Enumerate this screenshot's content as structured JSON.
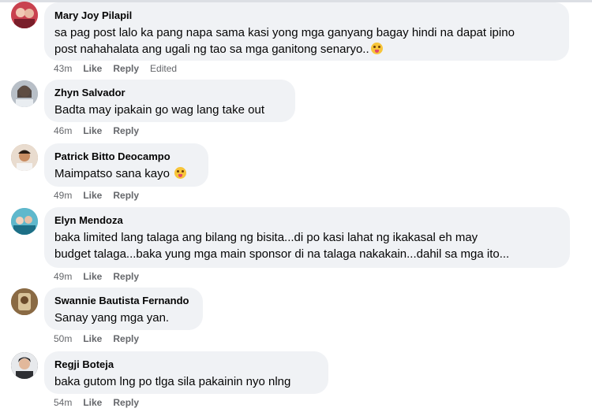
{
  "comments": [
    {
      "author": "Mary Joy Pilapil",
      "text_lines": [
        "sa pag post lalo ka pang napa sama kasi yong mga ganyang bagay hindi na dapat ipino",
        "post nahahalata ang ugali ng tao sa mga ganitong senaryo.."
      ],
      "emoji": "tongue-face-emoji",
      "time": "43m",
      "like": "Like",
      "reply": "Reply",
      "edited": "Edited",
      "avatar_color": "#d64d5a"
    },
    {
      "author": "Zhyn Salvador",
      "text_lines": [
        "Badta may ipakain go wag lang take out"
      ],
      "time": "46m",
      "like": "Like",
      "reply": "Reply",
      "avatar_color": "#9aa3ad"
    },
    {
      "author": "Patrick Bitto Deocampo",
      "text_lines": [
        "Maimpatso sana kayo "
      ],
      "emoji": "tongue-face-emoji",
      "time": "49m",
      "like": "Like",
      "reply": "Reply",
      "avatar_color": "#b58a63"
    },
    {
      "author": "Elyn Mendoza",
      "text_lines": [
        "baka limited lang talaga ang bilang ng bisita...di po kasi lahat ng ikakasal eh may",
        "budget talaga...baka yung mga main sponsor di na talaga nakakain...dahil sa mga ito..."
      ],
      "time": "49m",
      "like": "Like",
      "reply": "Reply",
      "avatar_color": "#3f9fb8"
    },
    {
      "author": "Swannie Bautista Fernando",
      "text_lines": [
        "Sanay yang mga yan."
      ],
      "time": "50m",
      "like": "Like",
      "reply": "Reply",
      "avatar_color": "#7a5a36"
    },
    {
      "author": "Regji Boteja",
      "text_lines": [
        "baka gutom lng po tlga sila pakainin nyo nlng"
      ],
      "time": "54m",
      "like": "Like",
      "reply": "Reply",
      "avatar_color": "#2e2f33"
    }
  ]
}
